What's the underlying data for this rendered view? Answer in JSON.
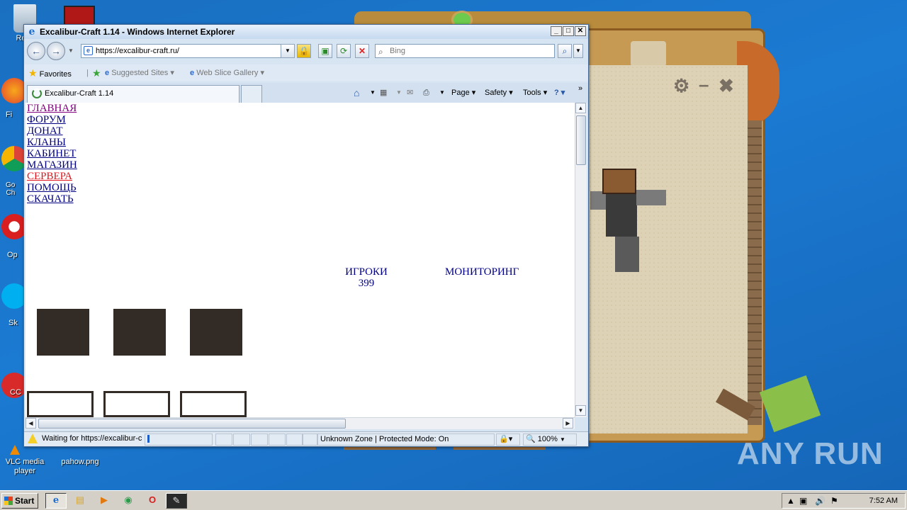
{
  "desktop": {
    "icons": [
      {
        "label": "Recy",
        "icon": "recycle-bin-icon"
      },
      {
        "label": "Fi",
        "icon": "firefox-icon"
      },
      {
        "label": "Go\nCh",
        "icon": "chrome-icon"
      },
      {
        "label": "Op",
        "icon": "opera-icon"
      },
      {
        "label": "Sk",
        "icon": "skype-icon"
      },
      {
        "label": "CC",
        "icon": "ccleaner-icon"
      },
      {
        "label": "VLC media player",
        "icon": "vlc-icon"
      },
      {
        "label": "pahow.png",
        "icon": "image-file-icon"
      }
    ]
  },
  "ie": {
    "title": "Excalibur-Craft 1.14 - Windows Internet Explorer",
    "window_buttons": [
      "_",
      "□",
      "✕"
    ],
    "address": "https://excalibur-craft.ru/",
    "search_placeholder": "Bing",
    "favorites": {
      "favorites_label": "Favorites",
      "suggested": "Suggested Sites ▾",
      "web_slice": "Web Slice Gallery ▾"
    },
    "tab_label": "Excalibur-Craft 1.14",
    "commands": {
      "page": "Page ▾",
      "safety": "Safety ▾",
      "tools": "Tools ▾",
      "help": "? ▾",
      "more": "»"
    },
    "status": {
      "text": "Waiting for https://excalibur-c",
      "zone": "Unknown Zone | Protected Mode: On",
      "zoom": "100%"
    }
  },
  "page": {
    "nav": [
      "ГЛАВНАЯ",
      "ФОРУМ",
      "ДОНАТ",
      "КЛАНЫ",
      "КАБИНЕТ",
      "МАГАЗИН",
      "СЕРВЕРА",
      "ПОМОЩЬ",
      "СКАЧАТЬ"
    ],
    "players_label": "ИГРОКИ",
    "players_count": "399",
    "monitoring_label": "МОНИТОРИНГ"
  },
  "taskbar": {
    "start": "Start",
    "clock": "7:52 AM"
  },
  "watermark": "ANY RUN",
  "colors": {
    "desktop_bg": "#1b7ad2",
    "link": "#000080",
    "link_visited": "#800080",
    "link_active": "#e0141c",
    "block": "#332b26"
  }
}
